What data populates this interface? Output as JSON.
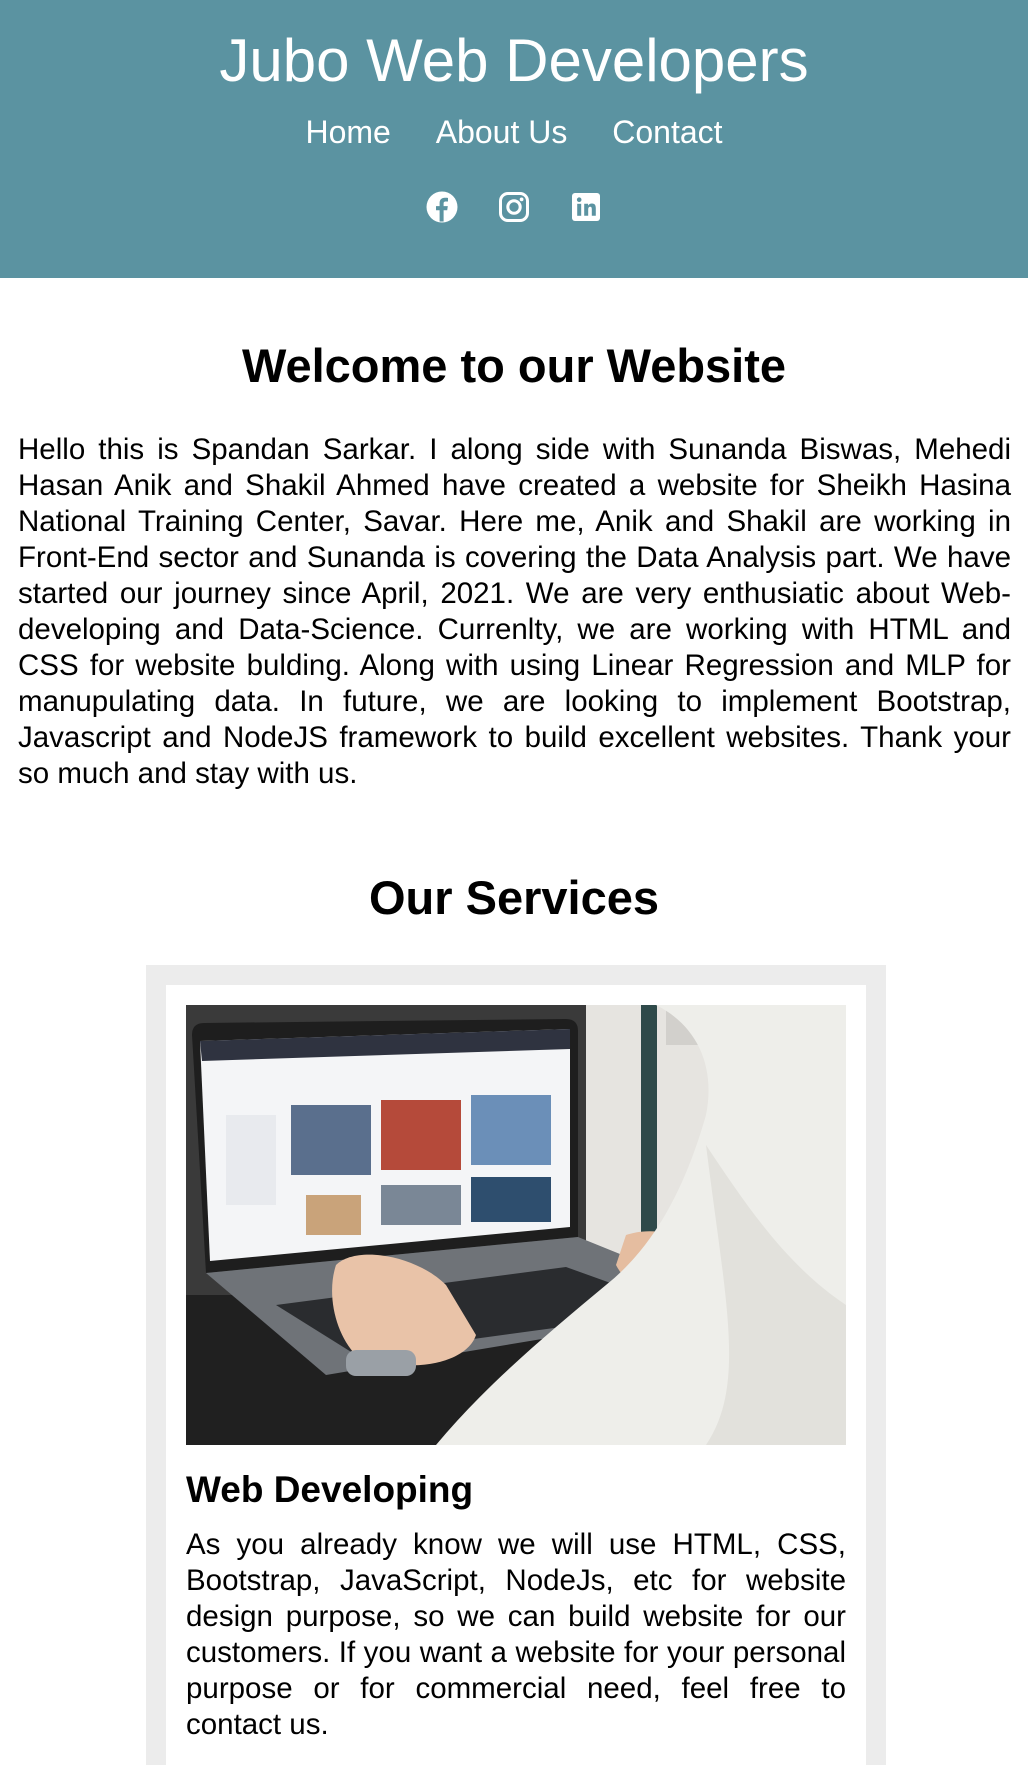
{
  "header": {
    "title": "Jubo Web Developers",
    "bg_color": "#5b93a1",
    "nav": [
      {
        "label": "Home"
      },
      {
        "label": "About Us"
      },
      {
        "label": "Contact"
      }
    ],
    "social": [
      {
        "icon": "facebook-icon"
      },
      {
        "icon": "instagram-icon"
      },
      {
        "icon": "linkedin-icon"
      }
    ]
  },
  "welcome": {
    "heading": "Welcome to our Website",
    "text": "Hello this is Spandan Sarkar. I along side with Sunanda Biswas, Mehedi Hasan Anik and Shakil Ahmed have created a website for Sheikh Hasina National Training Center, Savar. Here me, Anik and Shakil are working in Front-End sector and Sunanda is covering the Data Analysis part. We have started our journey since April, 2021. We are very enthusiatic about Web-developing and Data-Science. Currenlty, we are working with HTML and CSS for website bulding. Along with using Linear Regression and MLP for manupulating data. In future, we are looking to implement Bootstrap, Javascript and NodeJS framework to build excellent websites. Thank your so much and stay with us."
  },
  "services": {
    "heading": "Our Services",
    "items": [
      {
        "image_icon": "laptop-photo",
        "title": "Web Developing",
        "text": "As you already know we will use HTML, CSS, Bootstrap, JavaScript, NodeJs, etc for website design purpose, so we can build website for our customers. If you want a website for your personal purpose or for commercial need, feel free to contact us."
      }
    ]
  }
}
